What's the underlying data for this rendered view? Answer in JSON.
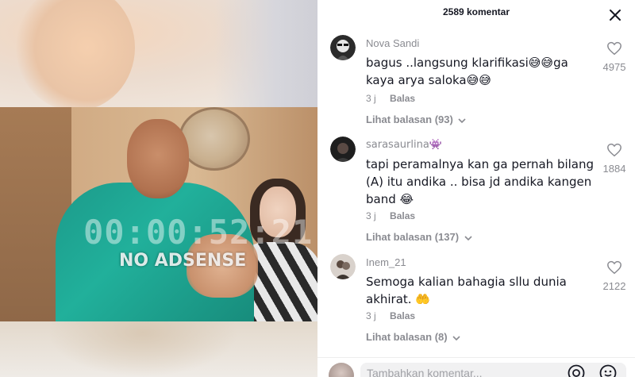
{
  "video": {
    "timecode": "00:00:52:21",
    "watermark": "NO ADSENSE"
  },
  "panel": {
    "title": "2589 komentar",
    "close_icon": "close-icon"
  },
  "comments": [
    {
      "username": "Nova Sandi",
      "text": "bagus ..langsung klarifikasi😅😅ga kaya arya saloka😅😅",
      "time": "3 j",
      "reply_label": "Balas",
      "see_replies": "Lihat balasan (93)",
      "likes": "4975"
    },
    {
      "username": "sarasaurlina👾",
      "text": "tapi peramalnya kan ga pernah bilang (A) itu andika .. bisa jd andika kangen band 😂",
      "time": "3 j",
      "reply_label": "Balas",
      "see_replies": "Lihat balasan (137)",
      "likes": "1884"
    },
    {
      "username": "Inem_21",
      "text": "Semoga kalian bahagia sllu dunia akhirat. 🤲",
      "time": "3 j",
      "reply_label": "Balas",
      "see_replies": "Lihat balasan (8)",
      "likes": "2122"
    }
  ],
  "footer": {
    "placeholder": "Tambahkan komentar...",
    "icons": [
      "at-icon",
      "emoji-icon"
    ]
  },
  "colors": {
    "text": "#161823",
    "muted": "#8a8b91"
  }
}
